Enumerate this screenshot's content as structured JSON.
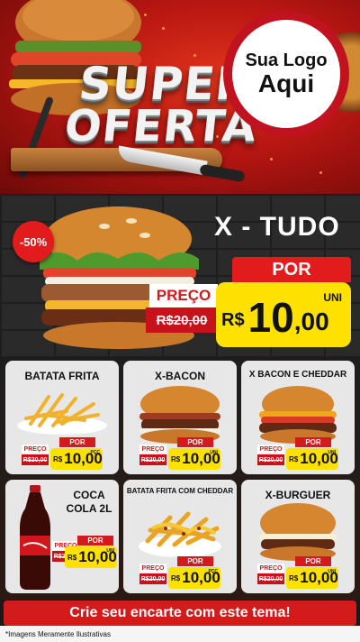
{
  "hero": {
    "title_line1": "SUPER",
    "title_line2": "OFERTA",
    "logo_line1": "Sua Logo",
    "logo_line2": "Aqui"
  },
  "feature": {
    "discount": "-50%",
    "name": "X - TUDO",
    "por_label": "POR",
    "preco_label": "PREÇO",
    "old_price": "R$20,00",
    "currency": "R$",
    "price_int": "10",
    "price_dec": ",00",
    "unit": "UNI"
  },
  "cards": [
    {
      "title": "BATATA FRITA",
      "preco_label": "PREÇO",
      "old_price": "R$20,00",
      "por_label": "POR",
      "currency": "R$",
      "price": "10,00",
      "unit": "PÇC"
    },
    {
      "title": "X-BACON",
      "preco_label": "PREÇO",
      "old_price": "R$20,00",
      "por_label": "POR",
      "currency": "R$",
      "price": "10,00",
      "unit": "UNI"
    },
    {
      "title": "X BACON E CHEDDAR",
      "preco_label": "PREÇO",
      "old_price": "R$20,00",
      "por_label": "POR",
      "currency": "R$",
      "price": "10,00",
      "unit": "UNI"
    },
    {
      "title_line1": "COCA",
      "title_line2": "COLA 2L",
      "preco_label": "PREÇO",
      "old_price": "R$20,00",
      "por_label": "POR",
      "currency": "R$",
      "price": "10,00",
      "unit": "UNI"
    },
    {
      "title": "BATATA FRITA COM CHEDDAR",
      "preco_label": "PREÇO",
      "old_price": "R$20,00",
      "por_label": "POR",
      "currency": "R$",
      "price": "10,00",
      "unit": "PÇC"
    },
    {
      "title": "X-BURGUER",
      "preco_label": "PREÇO",
      "old_price": "R$20,00",
      "por_label": "POR",
      "currency": "R$",
      "price": "10,00",
      "unit": "UNI"
    }
  ],
  "cta": {
    "label": "Crie seu encarte com este tema!"
  },
  "footer": {
    "note": "*Imagens Meramente Ilustrativas"
  }
}
